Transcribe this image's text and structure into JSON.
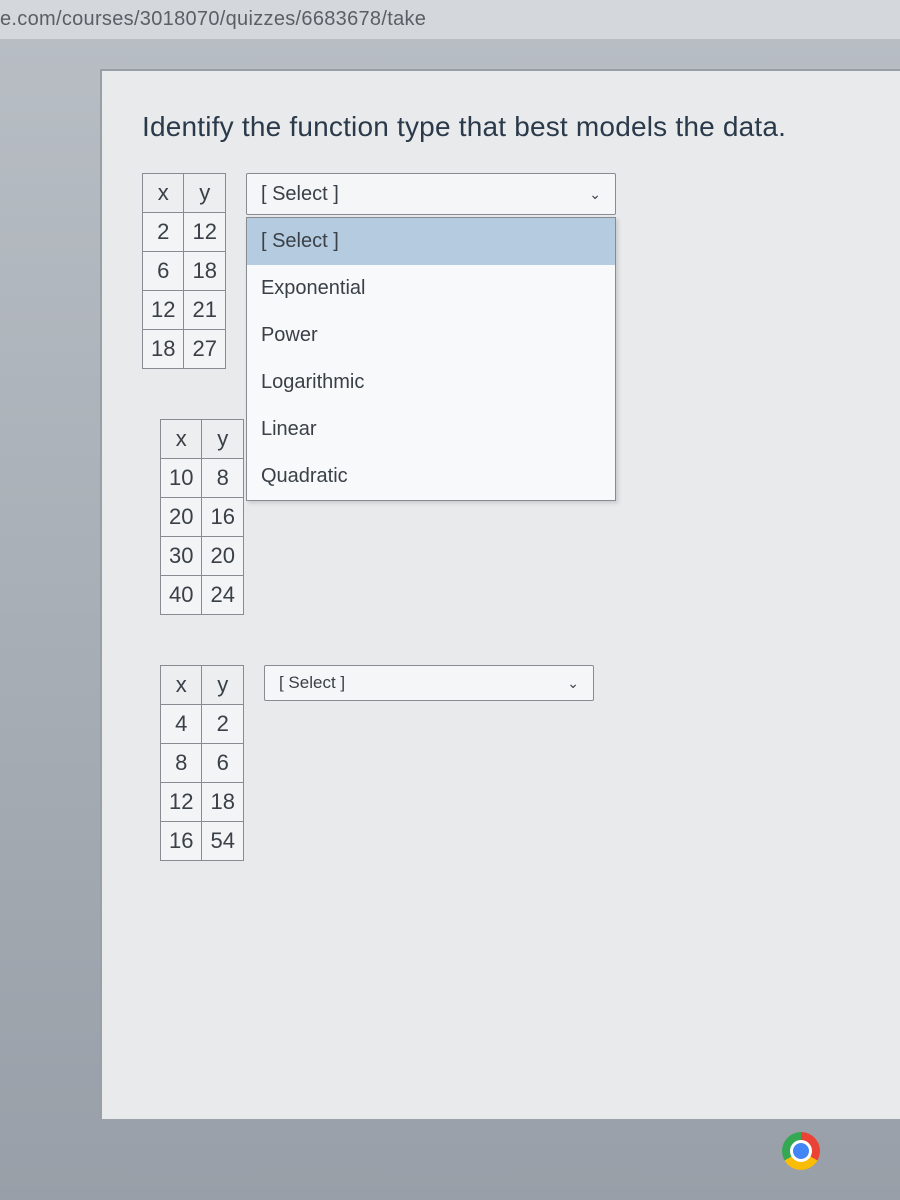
{
  "url": "e.com/courses/3018070/quizzes/6683678/take",
  "question": "Identify the function type that best models the data.",
  "select_placeholder": "[ Select ]",
  "dropdown_options": [
    "[ Select ]",
    "Exponential",
    "Power",
    "Logarithmic",
    "Linear",
    "Quadratic"
  ],
  "tables": [
    {
      "header": {
        "x": "x",
        "y": "y"
      },
      "rows": [
        {
          "x": "2",
          "y": "12"
        },
        {
          "x": "6",
          "y": "18"
        },
        {
          "x": "12",
          "y": "21"
        },
        {
          "x": "18",
          "y": "27"
        }
      ]
    },
    {
      "header": {
        "x": "x",
        "y": "y"
      },
      "rows": [
        {
          "x": "10",
          "y": "8"
        },
        {
          "x": "20",
          "y": "16"
        },
        {
          "x": "30",
          "y": "20"
        },
        {
          "x": "40",
          "y": "24"
        }
      ]
    },
    {
      "header": {
        "x": "x",
        "y": "y"
      },
      "rows": [
        {
          "x": "4",
          "y": "2"
        },
        {
          "x": "8",
          "y": "6"
        },
        {
          "x": "12",
          "y": "18"
        },
        {
          "x": "16",
          "y": "54"
        }
      ]
    }
  ]
}
